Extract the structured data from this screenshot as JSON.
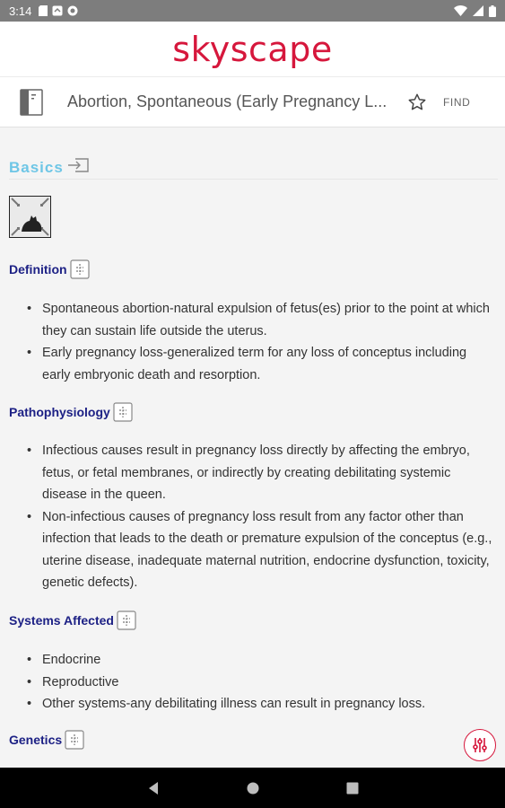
{
  "status": {
    "time": "3:14"
  },
  "brand": {
    "name": "skyscape"
  },
  "topbar": {
    "title": "Abortion, Spontaneous (Early Pregnancy L...",
    "find_label": "FIND"
  },
  "content": {
    "basics_title": "Basics",
    "definition": {
      "title": "Definition",
      "bullets": [
        "Spontaneous abortion-natural expulsion of fetus(es) prior to the point at which they can sustain life outside the uterus.",
        "Early pregnancy loss-generalized term for any loss of conceptus including early embryonic death and resorption."
      ]
    },
    "pathophysiology": {
      "title": "Pathophysiology",
      "bullets": [
        "Infectious causes result in pregnancy loss directly by affecting the embryo, fetus, or fetal membranes, or indirectly by creating debilitating systemic disease in the queen.",
        "Non-infectious causes of pregnancy loss result from any factor other than infection that leads to the death or premature expulsion of the conceptus (e.g., uterine disease, inadequate maternal nutrition, endocrine dysfunction, toxicity, genetic defects)."
      ]
    },
    "systems": {
      "title": "Systems Affected",
      "bullets": [
        "Endocrine",
        "Reproductive",
        "Other systems-any debilitating illness can result in pregnancy loss."
      ]
    },
    "genetics": {
      "title": "Genetics"
    }
  },
  "colors": {
    "brand": "#d6173c",
    "heading": "#1d2185",
    "basics": "#6ec6e6",
    "status_bar": "#7d7d7d"
  },
  "icons": [
    "book-icon",
    "star-icon",
    "collapse-icon",
    "cat-icon",
    "expand-icon",
    "tune-icon",
    "back-icon",
    "home-icon",
    "recents-icon"
  ]
}
